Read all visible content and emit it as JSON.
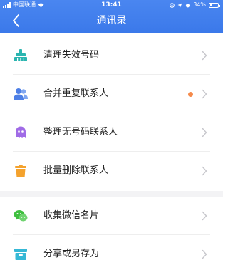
{
  "status_bar": {
    "carrier": "中国联通",
    "time": "13:41",
    "battery_text": "34%",
    "battery_level": 0.34
  },
  "nav": {
    "title": "通讯录",
    "back_icon": "chevron-left-icon"
  },
  "section1": {
    "items": [
      {
        "label": "清理失效号码",
        "icon": "broom-icon",
        "icon_color": "#2bb5b0"
      },
      {
        "label": "合并重复联系人",
        "icon": "contacts-icon",
        "icon_color": "#4d7fe6",
        "badge_color": "#f58a4b"
      },
      {
        "label": "整理无号码联系人",
        "icon": "ghost-icon",
        "icon_color": "#a06be6"
      },
      {
        "label": "批量删除联系人",
        "icon": "trash-icon",
        "icon_color": "#f4a22d"
      }
    ]
  },
  "section2": {
    "items": [
      {
        "label": "收集微信名片",
        "icon": "wechat-icon",
        "icon_color": "#3fbf3f"
      },
      {
        "label": "分享或另存为",
        "icon": "archive-box-icon",
        "icon_color": "#35b8d6"
      }
    ]
  },
  "colors": {
    "header": "#3b79ea",
    "chevron": "#c7c7cc",
    "divider": "#eeeeee"
  }
}
